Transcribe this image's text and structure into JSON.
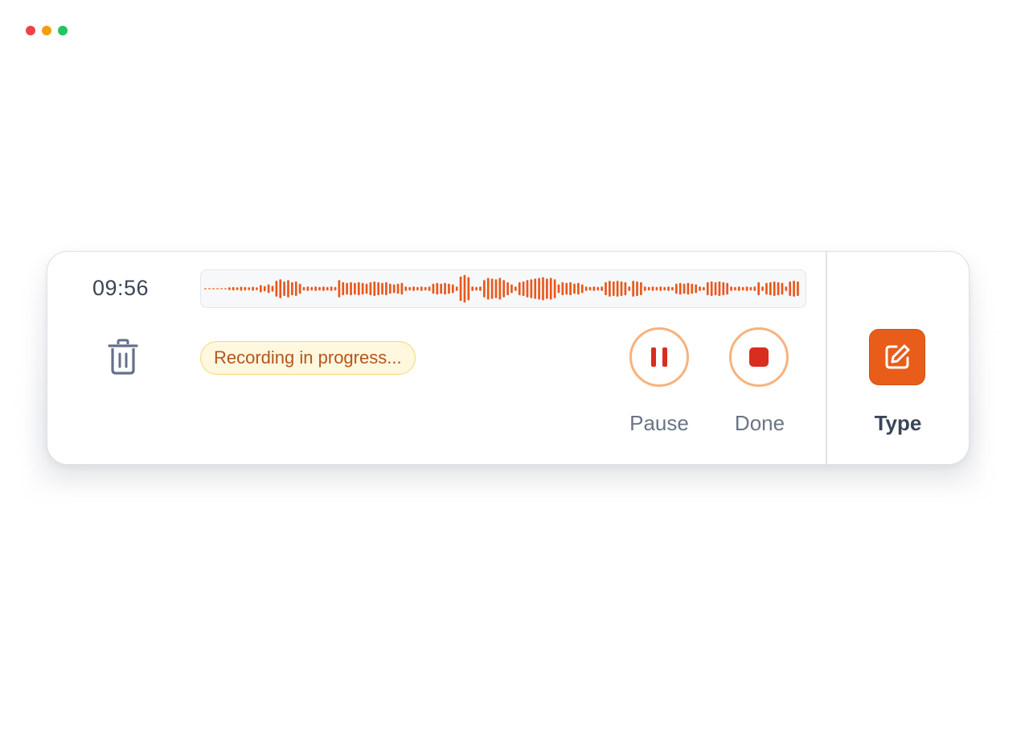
{
  "window": {
    "dots": [
      {
        "name": "close",
        "color": "#ef4444"
      },
      {
        "name": "minimize",
        "color": "#f59e0b"
      },
      {
        "name": "maximize",
        "color": "#22c55e"
      }
    ]
  },
  "recorder": {
    "timer": "09:56",
    "status": "Recording in progress...",
    "waveform_color": "#e8581c",
    "waveform_levels": [
      0.1,
      0.12,
      0.1,
      0.14,
      0.12,
      0.1,
      0.14,
      0.1,
      0.25,
      0.18,
      0.3,
      0.2,
      0.55,
      0.65,
      0.5,
      0.6,
      0.45,
      0.5,
      0.35,
      0.12,
      0.15,
      0.12,
      0.15,
      0.12,
      0.15,
      0.12,
      0.15,
      0.12,
      0.6,
      0.45,
      0.4,
      0.45,
      0.4,
      0.45,
      0.4,
      0.35,
      0.45,
      0.5,
      0.45,
      0.4,
      0.45,
      0.35,
      0.3,
      0.35,
      0.4,
      0.15,
      0.12,
      0.15,
      0.12,
      0.15,
      0.12,
      0.15,
      0.35,
      0.4,
      0.35,
      0.4,
      0.35,
      0.3,
      0.15,
      0.85,
      0.95,
      0.8,
      0.15,
      0.12,
      0.15,
      0.6,
      0.75,
      0.7,
      0.65,
      0.75,
      0.6,
      0.45,
      0.3,
      0.15,
      0.45,
      0.5,
      0.6,
      0.65,
      0.7,
      0.75,
      0.8,
      0.7,
      0.75,
      0.65,
      0.3,
      0.45,
      0.4,
      0.45,
      0.35,
      0.4,
      0.3,
      0.15,
      0.12,
      0.15,
      0.12,
      0.15,
      0.45,
      0.55,
      0.5,
      0.55,
      0.5,
      0.45,
      0.15,
      0.55,
      0.5,
      0.45,
      0.15,
      0.12,
      0.15,
      0.12,
      0.15,
      0.12,
      0.15,
      0.12,
      0.35,
      0.4,
      0.35,
      0.4,
      0.35,
      0.3,
      0.15,
      0.12,
      0.45,
      0.5,
      0.45,
      0.5,
      0.45,
      0.4,
      0.15,
      0.12,
      0.15,
      0.12,
      0.15,
      0.12,
      0.15,
      0.45,
      0.15,
      0.4,
      0.45,
      0.5,
      0.45,
      0.4,
      0.15,
      0.5,
      0.55,
      0.5
    ],
    "controls": {
      "pause_label": "Pause",
      "done_label": "Done",
      "type_label": "Type"
    },
    "colors": {
      "accent": "#e85d1a",
      "stop_red": "#d92d20",
      "ring": "#f8b27b",
      "badge_bg": "#fff7de",
      "badge_text": "#b5551b"
    }
  }
}
